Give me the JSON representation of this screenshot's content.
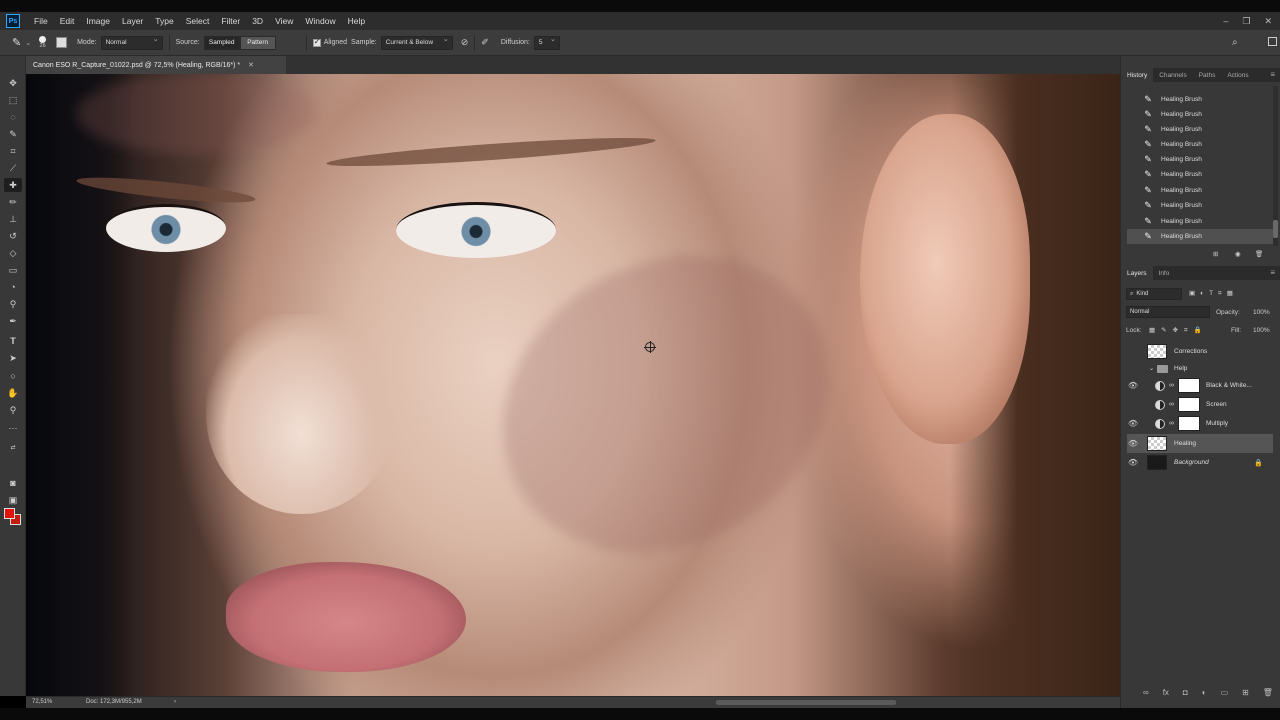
{
  "app": {
    "logo": "Ps"
  },
  "menu": [
    "File",
    "Edit",
    "Image",
    "Layer",
    "Type",
    "Select",
    "Filter",
    "3D",
    "View",
    "Window",
    "Help"
  ],
  "window_controls": {
    "minimize": "–",
    "restore": "❐",
    "close": "✕"
  },
  "options": {
    "brush_size": "26",
    "mode_label": "Mode:",
    "mode_value": "Normal",
    "source_label": "Source:",
    "source_sampled": "Sampled",
    "source_pattern": "Pattern",
    "aligned_label": "Aligned",
    "sample_label": "Sample:",
    "sample_value": "Current & Below",
    "diffusion_label": "Diffusion:",
    "diffusion_value": "5"
  },
  "document_tab": {
    "title": "Canon ESO R_Capture_01022.psd @ 72,5% (Healing, RGB/16*) *",
    "close": "✕"
  },
  "status": {
    "zoom": "72,51%",
    "doc": "Doc: 172,3M/955,2M",
    "arrow": "›"
  },
  "history": {
    "tabs": [
      "History",
      "Channels",
      "Paths",
      "Actions"
    ],
    "items": [
      "Healing Brush",
      "Healing Brush",
      "Healing Brush",
      "Healing Brush",
      "Healing Brush",
      "Healing Brush",
      "Healing Brush",
      "Healing Brush",
      "Healing Brush",
      "Healing Brush"
    ]
  },
  "layers": {
    "tabs": [
      "Layers",
      "Info"
    ],
    "kind_label": "Kind",
    "blend_mode": "Normal",
    "opacity_label": "Opacity:",
    "opacity_value": "100%",
    "lock_label": "Lock:",
    "fill_label": "Fill:",
    "fill_value": "100%",
    "items": [
      {
        "name": "Corrections",
        "visible": false,
        "type": "layer"
      },
      {
        "name": "Help",
        "visible": false,
        "type": "group"
      },
      {
        "name": "Black & White...",
        "visible": true,
        "type": "adjustment"
      },
      {
        "name": "Screen",
        "visible": false,
        "type": "adjustment"
      },
      {
        "name": "Multiply",
        "visible": true,
        "type": "adjustment"
      },
      {
        "name": "Healing",
        "visible": true,
        "type": "layer",
        "selected": true
      },
      {
        "name": "Background",
        "visible": true,
        "type": "background"
      }
    ]
  },
  "colors": {
    "foreground": "#e0140a",
    "background": "#c41b10",
    "accent": "#31a8ff"
  }
}
